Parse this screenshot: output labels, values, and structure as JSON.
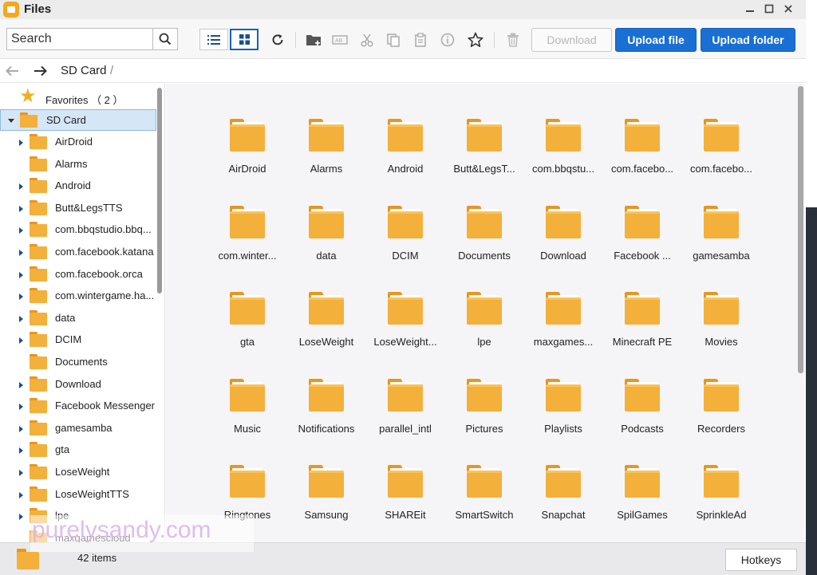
{
  "window": {
    "title": "Files",
    "controls": [
      "minimize-icon",
      "maximize-icon",
      "close-icon"
    ]
  },
  "toolbar": {
    "search_placeholder": "Search",
    "download_label": "Download",
    "upload_file_label": "Upload file",
    "upload_folder_label": "Upload folder",
    "icons": [
      "list-view-icon",
      "grid-view-icon",
      "refresh-icon",
      "new-folder-icon",
      "rename-icon",
      "cut-icon",
      "copy-icon",
      "paste-icon",
      "info-icon",
      "favorite-star-icon",
      "delete-icon"
    ]
  },
  "address": {
    "crumb": "SD Card",
    "separator": "/"
  },
  "sidebar": {
    "favorites_label": "Favorites （ 2 ）",
    "root_label": "SD Card",
    "items": [
      {
        "label": "AirDroid",
        "expandable": true
      },
      {
        "label": "Alarms",
        "expandable": false
      },
      {
        "label": "Android",
        "expandable": true
      },
      {
        "label": "Butt&LegsTTS",
        "expandable": true
      },
      {
        "label": "com.bbqstudio.bbq...",
        "expandable": true
      },
      {
        "label": "com.facebook.katana",
        "expandable": true
      },
      {
        "label": "com.facebook.orca",
        "expandable": true
      },
      {
        "label": "com.wintergame.ha...",
        "expandable": true
      },
      {
        "label": "data",
        "expandable": true
      },
      {
        "label": "DCIM",
        "expandable": true
      },
      {
        "label": "Documents",
        "expandable": false
      },
      {
        "label": "Download",
        "expandable": true
      },
      {
        "label": "Facebook Messenger",
        "expandable": true
      },
      {
        "label": "gamesamba",
        "expandable": true
      },
      {
        "label": "gta",
        "expandable": true
      },
      {
        "label": "LoseWeight",
        "expandable": true
      },
      {
        "label": "LoseWeightTTS",
        "expandable": true
      },
      {
        "label": "lpe",
        "expandable": true
      },
      {
        "label": "maxgamescloud",
        "expandable": false
      }
    ]
  },
  "grid": {
    "items": [
      "AirDroid",
      "Alarms",
      "Android",
      "Butt&LegsT...",
      "com.bbqstu...",
      "com.facebo...",
      "com.facebo...",
      "com.winter...",
      "data",
      "DCIM",
      "Documents",
      "Download",
      "Facebook ...",
      "gamesamba",
      "gta",
      "LoseWeight",
      "LoseWeight...",
      "lpe",
      "maxgames...",
      "Minecraft PE",
      "Movies",
      "Music",
      "Notifications",
      "parallel_intl",
      "Pictures",
      "Playlists",
      "Podcasts",
      "Recorders",
      "Ringtones",
      "Samsung",
      "SHAREit",
      "SmartSwitch",
      "Snapchat",
      "SpilGames",
      "SprinkleAd"
    ]
  },
  "status": {
    "count": "42 items",
    "hotkeys_label": "Hotkeys"
  },
  "watermark": "purelysandy.com",
  "colors": {
    "accent": "#1a6fd4",
    "folder": "#f3b03a",
    "folder_tab": "#e8961f",
    "selection": "#d5e6f7"
  }
}
